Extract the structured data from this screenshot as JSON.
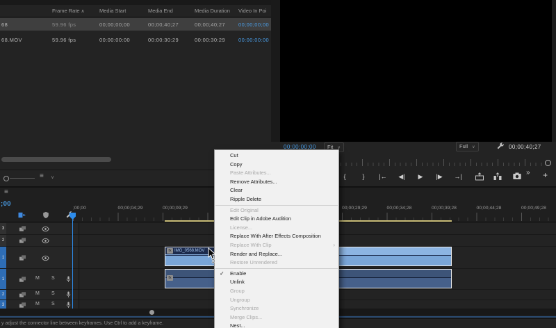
{
  "colors": {
    "accent_blue": "#4a9ee8",
    "playhead_blue": "#2d8ceb",
    "clip_video_blue": "#7aa6d8",
    "clip_audio_blue": "#46608a",
    "work_bar_yellow": "#c9bd78",
    "menu_background": "#f1f1f1"
  },
  "project_panel": {
    "columns": [
      {
        "label": "Frame Rate",
        "sort": "asc"
      },
      {
        "label": "Media Start"
      },
      {
        "label": "Media End"
      },
      {
        "label": "Media Duration"
      },
      {
        "label": "Video In Poi"
      }
    ],
    "rows": [
      {
        "name": "68",
        "frame_rate": "59.96 fps",
        "media_start": "00;00;00;00",
        "media_end": "00;00;40;27",
        "media_duration": "00;00;40;27",
        "video_in": "00;00;00;00",
        "selected": true
      },
      {
        "name": "68.MOV",
        "frame_rate": "59.96 fps",
        "media_start": "00:00:00:00",
        "media_end": "00:00:30:29",
        "media_duration": "00:00:30:29",
        "video_in": "00:00:00:00",
        "selected": false
      }
    ],
    "toolbar_icons": [
      "zoom-slider",
      "list-view-icon",
      "chevron-down-icon"
    ]
  },
  "program_monitor": {
    "timecode_current": "00;00;00;00",
    "fit_dropdown": "Fit",
    "quality_dropdown": "Full",
    "timecode_duration": "00;00;40;27",
    "settings_icon": "wrench-icon",
    "transport_icons": [
      "mark-in",
      "mark-out",
      "go-to-in",
      "step-back",
      "play",
      "step-forward",
      "go-to-out",
      "lift",
      "extract",
      "export-frame"
    ],
    "more_label": "»",
    "add_label": "+"
  },
  "timeline": {
    "panel_menu_icon": "hamburger-icon",
    "panel_timecode": ";00",
    "toolbar_icons": [
      "nest-toggle-icon",
      "linked-selection-icon",
      "timeline-settings-icon"
    ],
    "ruler_labels": [
      ";00;00",
      "00;00;04;29",
      "00;00;09;29",
      "00;00;29;29",
      "00;00;34;28",
      "00;00;39;28",
      "00;00;44;28",
      "00;00;49;28"
    ],
    "video_tracks": [
      {
        "label": "3",
        "targeted": false
      },
      {
        "label": "2",
        "targeted": false
      },
      {
        "label": "1",
        "targeted": true
      }
    ],
    "audio_tracks": [
      {
        "label": "1",
        "targeted": true
      },
      {
        "label": "2",
        "targeted": true
      },
      {
        "label": "3",
        "targeted": true
      }
    ],
    "audio_controls": {
      "mute": "M",
      "solo": "S"
    },
    "clips": {
      "video": {
        "name": "IMG_0568.MOV",
        "badge": "fx"
      },
      "audio": {
        "badge": "fx"
      }
    },
    "status_text": "y adjust the connector line between keyframes. Use Ctrl to add a keyframe."
  },
  "context_menu": {
    "items": [
      {
        "label": "Cut"
      },
      {
        "label": "Copy"
      },
      {
        "label": "Paste Attributes...",
        "disabled": true
      },
      {
        "label": "Remove Attributes..."
      },
      {
        "label": "Clear"
      },
      {
        "label": "Ripple Delete",
        "sep_after": true
      },
      {
        "label": "Edit Original",
        "disabled": true
      },
      {
        "label": "Edit Clip in Adobe Audition"
      },
      {
        "label": "License...",
        "disabled": true
      },
      {
        "label": "Replace With After Effects Composition"
      },
      {
        "label": "Replace With Clip",
        "disabled": true,
        "submenu": true
      },
      {
        "label": "Render and Replace..."
      },
      {
        "label": "Restore Unrendered",
        "disabled": true,
        "sep_after": true
      },
      {
        "label": "Enable",
        "checked": true
      },
      {
        "label": "Unlink"
      },
      {
        "label": "Group",
        "disabled": true
      },
      {
        "label": "Ungroup",
        "disabled": true
      },
      {
        "label": "Synchronize",
        "disabled": true
      },
      {
        "label": "Merge Clips...",
        "disabled": true
      },
      {
        "label": "Nest..."
      }
    ]
  }
}
